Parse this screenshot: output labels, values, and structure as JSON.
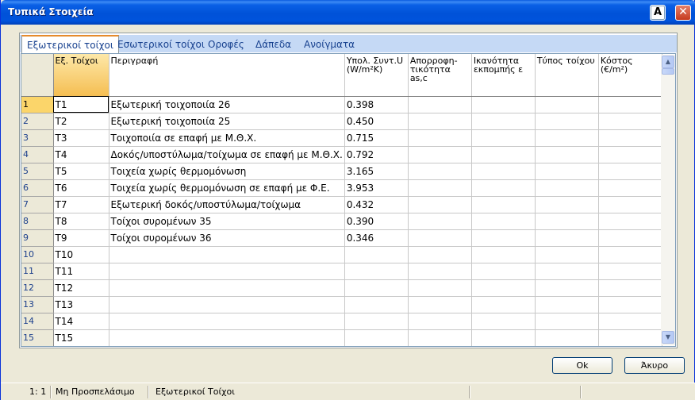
{
  "window": {
    "title": "Τυπικά Στοιχεία",
    "help_label": "A",
    "close_label": "✕"
  },
  "tabs": [
    {
      "label": "Εξωτερικοί τοίχοι",
      "active": true
    },
    {
      "label": "Εσωτερικοί τοίχοι"
    },
    {
      "label": "Οροφές"
    },
    {
      "label": "Δάπεδα"
    },
    {
      "label": "Ανοίγματα"
    }
  ],
  "grid": {
    "columns": [
      "Εξ. Τοίχοι",
      "Περιγραφή",
      "Υπολ. Συντ.U (W/m²K)",
      "Απορροφη- τικότητα as,c",
      "Ικανότητα εκπομπής ε",
      "Τύπος τοίχου",
      "Κόστος (€/m²)"
    ],
    "rows": [
      {
        "num": "1",
        "code": "T1",
        "desc": "Εξωτερική τοιχοποιία 26",
        "u": "0.398"
      },
      {
        "num": "2",
        "code": "T2",
        "desc": "Εξωτερική τοιχοποιία 25",
        "u": "0.450"
      },
      {
        "num": "3",
        "code": "T3",
        "desc": "Τοιχοποιία σε επαφή με Μ.Θ.Χ.",
        "u": "0.715"
      },
      {
        "num": "4",
        "code": "T4",
        "desc": "Δοκός/υποστύλωμα/τοίχωμα σε επαφή με Μ.Θ.Χ.",
        "u": "0.792"
      },
      {
        "num": "5",
        "code": "T5",
        "desc": "Τοιχεία χωρίς θερμομόνωση",
        "u": "3.165"
      },
      {
        "num": "6",
        "code": "T6",
        "desc": "Τοιχεία χωρίς θερμομόνωση σε επαφή με Φ.Ε.",
        "u": "3.953"
      },
      {
        "num": "7",
        "code": "T7",
        "desc": "Εξωτερική δοκός/υποστύλωμα/τοίχωμα",
        "u": "0.432"
      },
      {
        "num": "8",
        "code": "T8",
        "desc": "Τοίχοι συρομένων 35",
        "u": "0.390"
      },
      {
        "num": "9",
        "code": "T9",
        "desc": "Τοίχοι συρομένων 36",
        "u": "0.346"
      },
      {
        "num": "10",
        "code": "T10",
        "desc": "",
        "u": ""
      },
      {
        "num": "11",
        "code": "T11",
        "desc": "",
        "u": ""
      },
      {
        "num": "12",
        "code": "T12",
        "desc": "",
        "u": ""
      },
      {
        "num": "13",
        "code": "T13",
        "desc": "",
        "u": ""
      },
      {
        "num": "14",
        "code": "T14",
        "desc": "",
        "u": ""
      },
      {
        "num": "15",
        "code": "T15",
        "desc": "",
        "u": ""
      }
    ]
  },
  "buttons": {
    "ok": "Ok",
    "cancel": "Άκυρο"
  },
  "status": {
    "position": "1: 1",
    "access": "Μη Προσπελάσιμο",
    "section": "Εξωτερικοί Τοίχοι"
  },
  "colors": {
    "title_bar": "#0054e3",
    "selected_header": "#f5be52",
    "tab_active_accent": "#e68b2c"
  }
}
